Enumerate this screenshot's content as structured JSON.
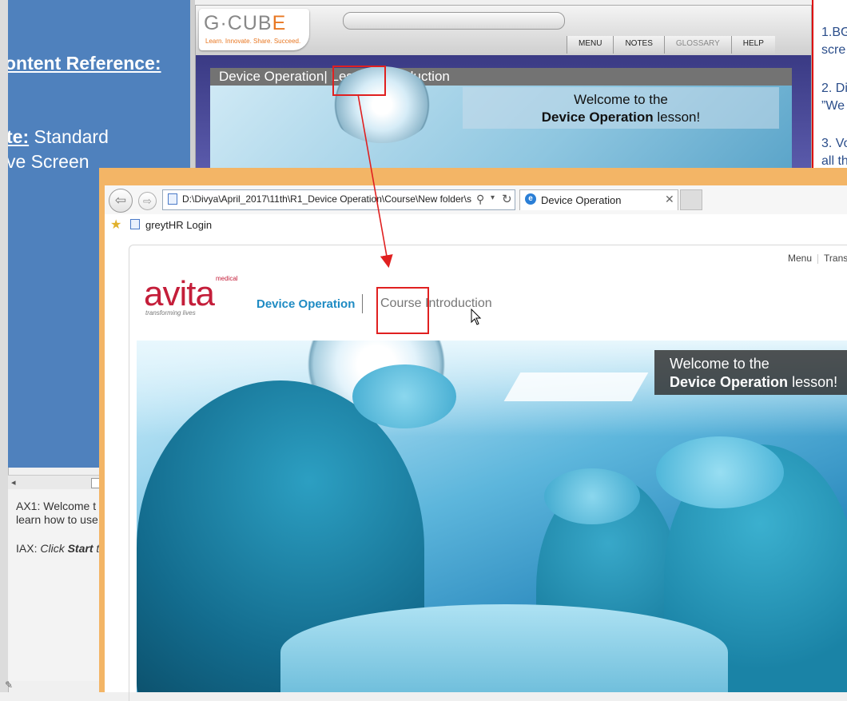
{
  "background_slide": {
    "content_reference": "ontent Reference:",
    "template_label": "te:",
    "template_value": " Standard",
    "screen_line": "ve Screen",
    "notes": {
      "ax1_line1": "AX1: Welcome t",
      "ax1_line2": "learn how to use",
      "iax_prefix": "IAX: ",
      "iax_click": "Click ",
      "iax_start": "Start",
      "iax_rest": " t"
    },
    "right_panel": [
      "1.BG",
      "scre",
      "2. Di",
      "”We",
      "3. Vo",
      "all th"
    ]
  },
  "gcube_preview": {
    "logo_text_grey": "G·CUB",
    "logo_text_orange": "E",
    "logo_tagline": "Learn. Innovate. Share. Succeed.",
    "menu_items": [
      "MENU",
      "NOTES",
      "GLOSSARY",
      "HELP"
    ],
    "breadcrumb_title": "Device Operation",
    "breadcrumb_lesson": "Lesson Introduction",
    "welcome_line1": "Welcome to the",
    "welcome_bold": "Device Operation",
    "welcome_rest": " lesson!"
  },
  "browser": {
    "address_url": "D:\\Divya\\April_2017\\11th\\R1_Device Operation\\Course\\New folder\\s",
    "tab_title": "Device Operation",
    "favorite_item": "greytHR Login",
    "icons": {
      "back": "back-arrow-icon",
      "forward": "forward-arrow-icon",
      "search": "search-icon",
      "refresh": "refresh-icon",
      "close_tab": "close-icon",
      "favorites": "favorites-star-icon"
    }
  },
  "course_page": {
    "top_menu": [
      "Menu",
      "Trans"
    ],
    "logo": {
      "word": "avita",
      "superscript": "medical",
      "tagline": "transforming lives"
    },
    "breadcrumb_title": "Device Operation",
    "breadcrumb_section": "Course Introduction",
    "welcome_line1": "Welcome to the",
    "welcome_bold": "Device Operation",
    "welcome_rest": " lesson!"
  },
  "annotation_colors": {
    "highlight": "#e02020",
    "brand_blue": "#1e8bc3",
    "brand_red": "#c41e3a"
  }
}
